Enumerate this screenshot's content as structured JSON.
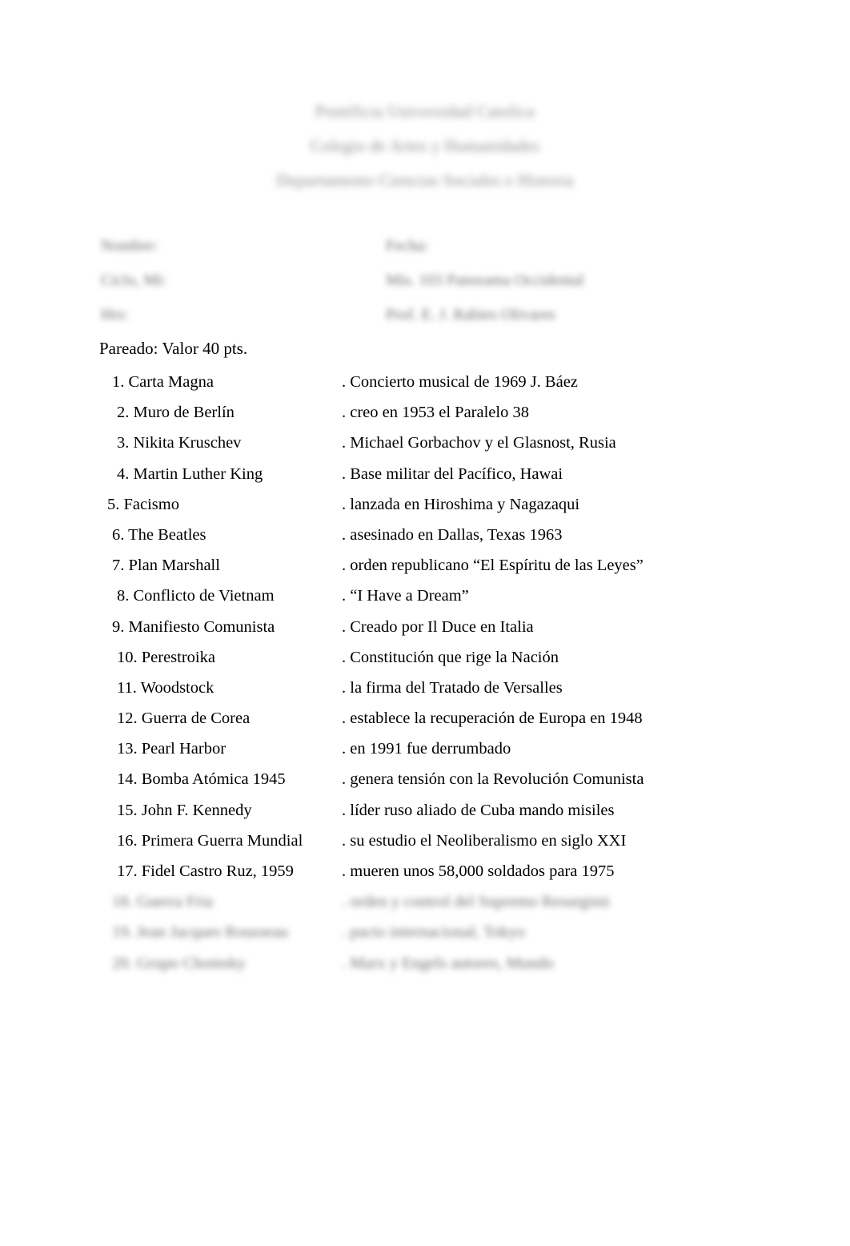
{
  "document": {
    "header_lines": [
      "Pontificia Universidad Catolica",
      "Colegio de Artes y Humanidades",
      "Departamento Ciencias Sociales e Historia"
    ],
    "form_fields": [
      {
        "left_label": "Nombre:",
        "right_label": "Fecha:"
      },
      {
        "left_label": "Ciclo, Mi:",
        "right_label": "Mis. 103 Panorama Occidental"
      },
      {
        "left_label": "Hrs:",
        "right_label": "Prof. E. J. Rabies Olivares"
      }
    ],
    "section_title": "Pareado: Valor 40 pts.",
    "columns": {
      "terms_header": "",
      "options_header": ""
    },
    "rows": [
      {
        "blank": "",
        "number": "1.",
        "term": "Carta Magna",
        "letter": "",
        "option": ". Concierto musical de 1969 J. Báez",
        "redacted": false,
        "indent": 0
      },
      {
        "blank": "",
        "number": "2.",
        "term": "Muro de Berlín",
        "letter": "",
        "option": ". creo en 1953 el Paralelo 38",
        "redacted": false,
        "indent": 1
      },
      {
        "blank": "",
        "number": "3.",
        "term": "Nikita Kruschev",
        "letter": "",
        "option": ". Michael Gorbachov y el Glasnost, Rusia",
        "redacted": false,
        "indent": 1
      },
      {
        "blank": "",
        "number": "4.",
        "term": "Martin Luther King",
        "letter": "",
        "option": ". Base militar del Pacífico, Hawai",
        "redacted": false,
        "indent": 1
      },
      {
        "blank": "",
        "number": "5.",
        "term": "Facismo",
        "letter": "",
        "option": ". lanzada en Hiroshima y Nagazaqui",
        "redacted": false,
        "indent": 2
      },
      {
        "blank": "",
        "number": "6.",
        "term": "The Beatles",
        "letter": "",
        "option": ". asesinado en Dallas, Texas 1963",
        "redacted": false,
        "indent": 0
      },
      {
        "blank": "",
        "number": "7.",
        "term": "Plan Marshall",
        "letter": "",
        "option": ". orden republicano “El Espíritu de las Leyes”",
        "redacted": false,
        "indent": 0
      },
      {
        "blank": "",
        "number": "8.",
        "term": "Conflicto de Vietnam",
        "letter": "",
        "option": ". “I Have a Dream”",
        "redacted": false,
        "indent": 1
      },
      {
        "blank": "",
        "number": "9.",
        "term": "Manifiesto Comunista",
        "letter": "",
        "option": ". Creado por Il Duce en Italia",
        "redacted": false,
        "indent": 0
      },
      {
        "blank": "",
        "number": "10.",
        "term": "Perestroika",
        "letter": "",
        "option": ". Constitución que rige la Nación",
        "redacted": false,
        "indent": 1
      },
      {
        "blank": "",
        "number": "11.",
        "term": "Woodstock",
        "letter": "",
        "option": ". la firma del Tratado de Versalles",
        "redacted": false,
        "indent": 1
      },
      {
        "blank": "",
        "number": "12.",
        "term": "Guerra de Corea",
        "letter": "",
        "option": ". establece la recuperación de Europa en 1948",
        "redacted": false,
        "indent": 1
      },
      {
        "blank": "",
        "number": "13.",
        "term": "Pearl Harbor",
        "letter": "",
        "option": ". en 1991 fue derrumbado",
        "redacted": false,
        "indent": 1
      },
      {
        "blank": "",
        "number": "14.",
        "term": "Bomba Atómica 1945",
        "letter": "",
        "option": ". genera tensión con la Revolución Comunista",
        "redacted": false,
        "indent": 1
      },
      {
        "blank": "",
        "number": "15.",
        "term": "John F. Kennedy",
        "letter": "",
        "option": ". líder ruso aliado de Cuba mando misiles",
        "redacted": false,
        "indent": 1
      },
      {
        "blank": "",
        "number": "16.",
        "term": "Primera Guerra Mundial",
        "letter": "",
        "option": ". su estudio el Neoliberalismo en siglo XXI",
        "redacted": false,
        "indent": 1
      },
      {
        "blank": "",
        "number": "17.",
        "term": "Fidel Castro Ruz, 1959",
        "letter": "",
        "option": ". mueren unos 58,000 soldados para 1975",
        "redacted": false,
        "indent": 1
      },
      {
        "blank": "",
        "number": "18.",
        "term": "Guerra Fria",
        "letter": "",
        "option": ". orden y control del Supremo Resurgimi",
        "redacted": true,
        "indent": 0
      },
      {
        "blank": "",
        "number": "19.",
        "term": "Jean Jacques Rousseau",
        "letter": "",
        "option": ". pacto internacional, Tokyo",
        "redacted": true,
        "indent": 0
      },
      {
        "blank": "",
        "number": "20.",
        "term": "Grupo Chomsky",
        "letter": "",
        "option": ". Marx y Engels autores, Mundo",
        "redacted": true,
        "indent": 0
      }
    ]
  }
}
